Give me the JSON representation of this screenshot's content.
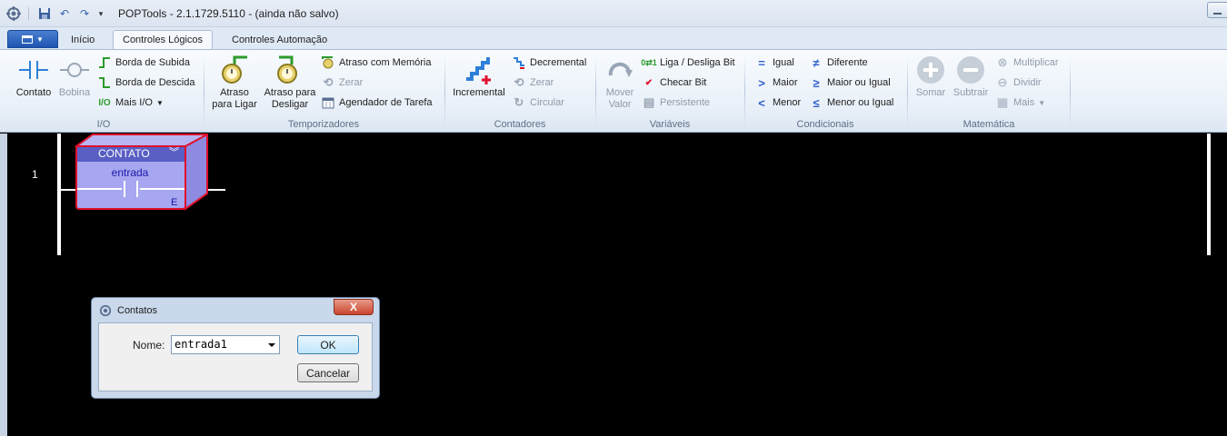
{
  "window": {
    "title": "POPTools - 2.1.1729.5110 - (ainda não salvo)"
  },
  "file_button": {
    "icon": "menu-icon"
  },
  "tabs": [
    {
      "label": "Início",
      "active": false
    },
    {
      "label": "Controles Lógicos",
      "active": true
    },
    {
      "label": "Controles Automação",
      "active": false
    }
  ],
  "ribbon": {
    "io": {
      "label": "I/O",
      "contato": "Contato",
      "bobina": "Bobina",
      "borda_subida": "Borda de Subida",
      "borda_descida": "Borda de Descida",
      "mais_io": "Mais I/O"
    },
    "temporizadores": {
      "label": "Temporizadores",
      "atraso_ligar_1": "Atraso",
      "atraso_ligar_2": "para Ligar",
      "atraso_desligar_1": "Atraso para",
      "atraso_desligar_2": "Desligar",
      "atraso_memoria": "Atraso com Memória",
      "zerar": "Zerar",
      "agendador": "Agendador de Tarefa"
    },
    "contadores": {
      "label": "Contadores",
      "incremental": "Incremental",
      "decremental": "Decremental",
      "zerar": "Zerar",
      "circular": "Circular"
    },
    "variaveis": {
      "label": "Variáveis",
      "mover_1": "Mover",
      "mover_2": "Valor",
      "liga_desliga": "Liga / Desliga Bit",
      "checar": "Checar Bit",
      "persistente": "Persistente"
    },
    "condicionais": {
      "label": "Condicionais",
      "igual": "Igual",
      "maior": "Maior",
      "menor": "Menor",
      "diferente": "Diferente",
      "maior_igual": "Maior ou Igual",
      "menor_igual": "Menor ou Igual"
    },
    "matematica": {
      "label": "Matemática",
      "somar": "Somar",
      "subtrair": "Subtrair",
      "multiplicar": "Multiplicar",
      "dividir": "Dividir",
      "mais": "Mais"
    }
  },
  "ladder": {
    "rung_number": "1",
    "block": {
      "type": "CONTATO",
      "name": "entrada",
      "flag": "E"
    }
  },
  "dialog": {
    "title": "Contatos",
    "close": "X",
    "name_label": "Nome:",
    "name_value": "entrada1",
    "ok": "OK",
    "cancel": "Cancelar"
  },
  "colors": {
    "ribbon_bg": "#e9f0f8",
    "ladder_bg": "#000000",
    "block_fill": "#a7a6f0",
    "block_border": "#e0102a",
    "block_header": "#5a5fc4"
  }
}
